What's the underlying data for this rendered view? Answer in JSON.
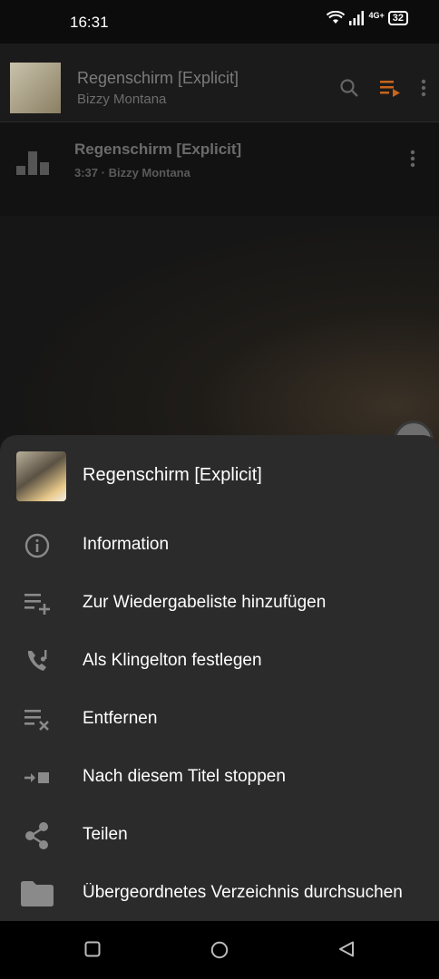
{
  "status": {
    "time": "16:31",
    "network": "4G+",
    "battery": "32"
  },
  "now_playing": {
    "title": "Regenschirm [Explicit]",
    "artist": "Bizzy Montana",
    "icons": [
      "search-icon",
      "queue-music-icon",
      "more-vert-icon"
    ],
    "accent_color": "#c8641d"
  },
  "queue": {
    "title": "Regenschirm [Explicit]",
    "subtitle": "3:37 · Bizzy Montana"
  },
  "sheet": {
    "title": "Regenschirm [Explicit]",
    "items": [
      {
        "label": "Information",
        "icon": "info-icon"
      },
      {
        "label": "Zur Wiedergabeliste hinzufügen",
        "icon": "playlist-add-icon"
      },
      {
        "label": "Als Klingelton festlegen",
        "icon": "ringtone-icon"
      },
      {
        "label": "Entfernen",
        "icon": "playlist-remove-icon"
      },
      {
        "label": "Nach diesem Titel stoppen",
        "icon": "stop-after-icon"
      },
      {
        "label": "Teilen",
        "icon": "share-icon"
      },
      {
        "label": "Übergeordnetes Verzeichnis durchsuchen",
        "icon": "folder-icon"
      }
    ]
  },
  "nav": {
    "icons": [
      "recents-icon",
      "home-icon",
      "back-icon"
    ]
  }
}
